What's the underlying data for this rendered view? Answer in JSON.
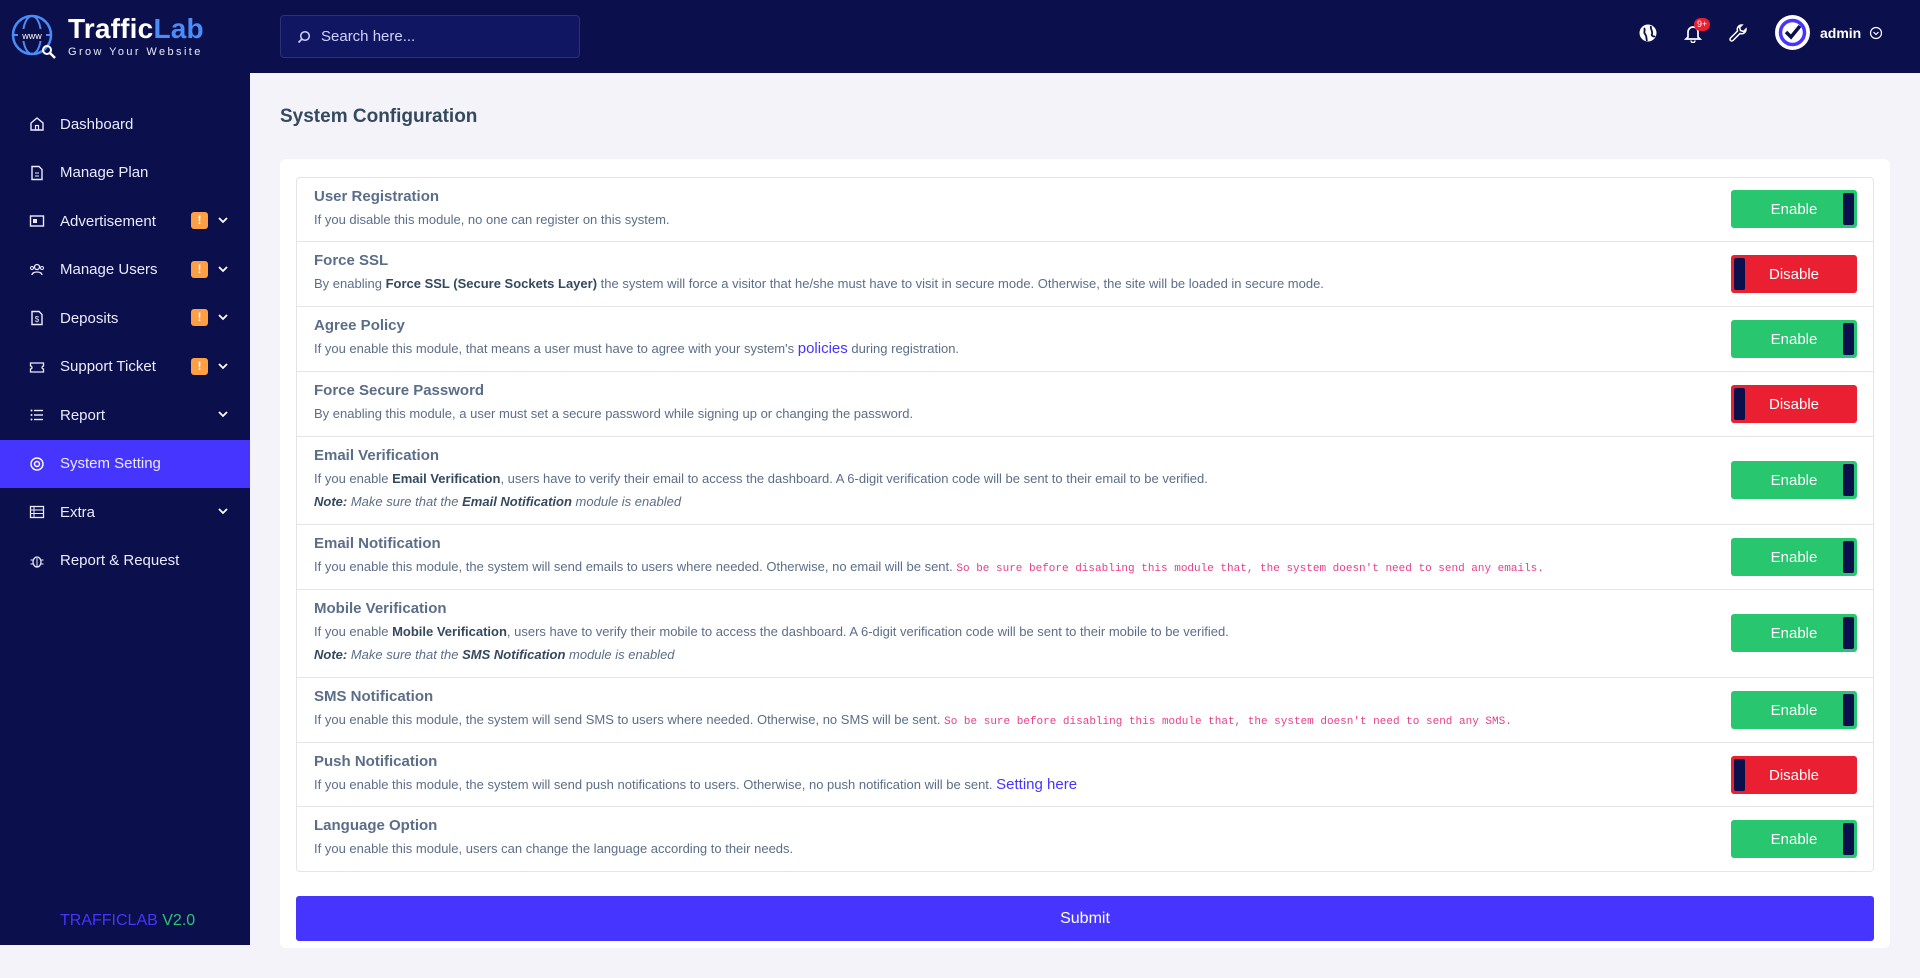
{
  "brand": {
    "name_part1": "Traffic",
    "name_part2": "Lab",
    "tagline": "Grow Your Website",
    "globe_text": "www"
  },
  "sidebar": {
    "items": [
      {
        "label": "Dashboard",
        "icon": "home-icon"
      },
      {
        "label": "Manage Plan",
        "icon": "file-icon"
      },
      {
        "label": "Advertisement",
        "icon": "ad-icon",
        "badge": "!"
      },
      {
        "label": "Manage Users",
        "icon": "users-icon",
        "badge": "!"
      },
      {
        "label": "Deposits",
        "icon": "deposit-icon",
        "badge": "!"
      },
      {
        "label": "Support Ticket",
        "icon": "ticket-icon",
        "badge": "!"
      },
      {
        "label": "Report",
        "icon": "list-icon"
      },
      {
        "label": "System Setting",
        "icon": "lifebuoy-icon"
      },
      {
        "label": "Extra",
        "icon": "server-icon"
      },
      {
        "label": "Report & Request",
        "icon": "bug-icon"
      }
    ],
    "version_name": "TRAFFICLAB",
    "version_number": "V2.0"
  },
  "topbar": {
    "search_placeholder": "Search here...",
    "notification_count": "9+",
    "username": "admin"
  },
  "page": {
    "title": "System Configuration"
  },
  "settings": [
    {
      "title": "User Registration",
      "desc": "If you disable this module, no one can register on this system.",
      "state": "Enable"
    },
    {
      "title": "Force SSL",
      "desc_pre": "By enabling ",
      "desc_bold": "Force SSL (Secure Sockets Layer)",
      "desc_post": " the system will force a visitor that he/she must have to visit in secure mode. Otherwise, the site will be loaded in secure mode.",
      "state": "Disable"
    },
    {
      "title": "Agree Policy",
      "desc_pre": "If you enable this module, that means a user must have to agree with your system's ",
      "desc_link": "policies",
      "desc_post": " during registration.",
      "state": "Enable"
    },
    {
      "title": "Force Secure Password",
      "desc": "By enabling this module, a user must set a secure password while signing up or changing the password.",
      "state": "Disable"
    },
    {
      "title": "Email Verification",
      "desc_pre": "If you enable ",
      "desc_bold": "Email Verification",
      "desc_post": ", users have to verify their email to access the dashboard. A 6-digit verification code will be sent to their email to be verified.",
      "note_label": "Note:",
      "note_pre": " Make sure that the ",
      "note_bold": "Email Notification",
      "note_post": " module is enabled",
      "state": "Enable"
    },
    {
      "title": "Email Notification",
      "desc": "If you enable this module, the system will send emails to users where needed. Otherwise, no email will be sent.",
      "warn": "So be sure before disabling this module that, the system doesn't need to send any emails.",
      "state": "Enable"
    },
    {
      "title": "Mobile Verification",
      "desc_pre": "If you enable ",
      "desc_bold": "Mobile Verification",
      "desc_post": ", users have to verify their mobile to access the dashboard. A 6-digit verification code will be sent to their mobile to be verified.",
      "note_label": "Note:",
      "note_pre": " Make sure that the ",
      "note_bold": "SMS Notification",
      "note_post": " module is enabled",
      "state": "Enable"
    },
    {
      "title": "SMS Notification",
      "desc": "If you enable this module, the system will send SMS to users where needed. Otherwise, no SMS will be sent.",
      "warn": "So be sure before disabling this module that, the system doesn't need to send any SMS.",
      "state": "Enable"
    },
    {
      "title": "Push Notification",
      "desc": "If you enable this module, the system will send push notifications to users. Otherwise, no push notification will be sent.",
      "link": "Setting here",
      "state": "Disable"
    },
    {
      "title": "Language Option",
      "desc": "If you enable this module, users can change the language according to their needs.",
      "state": "Enable"
    }
  ],
  "submit_label": "Submit",
  "colors": {
    "sidebar_bg": "#0b0f4b",
    "accent": "#4634ff",
    "enable": "#28c76f",
    "disable": "#ea1f31",
    "badge": "#ff9f43"
  }
}
